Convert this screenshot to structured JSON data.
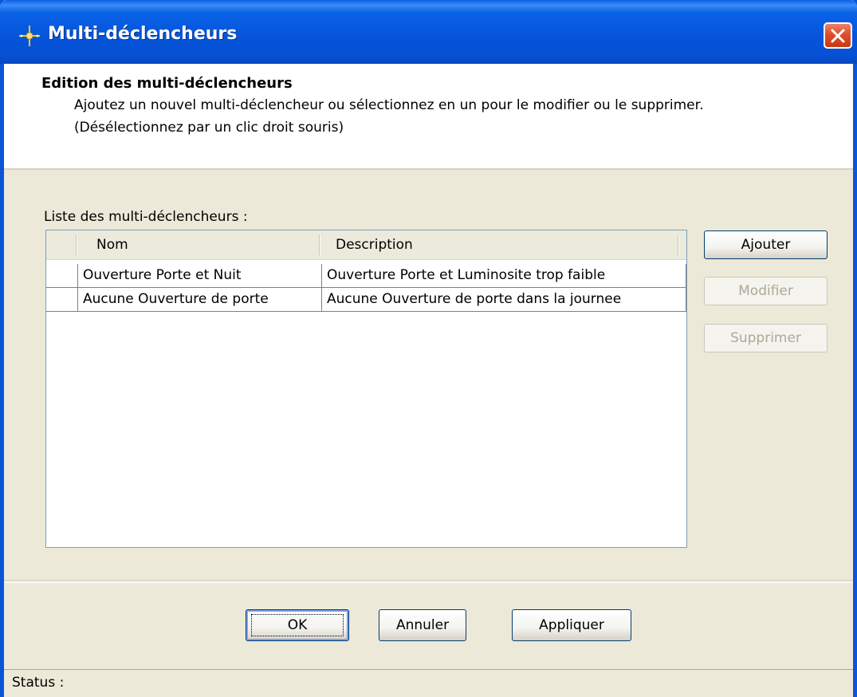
{
  "window": {
    "title": "Multi-déclencheurs",
    "title_icon": "trigger-icon",
    "close_icon": "close-icon"
  },
  "header": {
    "title": "Edition des multi-déclencheurs",
    "description_line1": "Ajoutez un nouvel multi-déclencheur ou sélectionnez en un pour le modifier ou le supprimer.",
    "description_line2": "(Désélectionnez par un clic droit souris)"
  },
  "list": {
    "label": "Liste des multi-déclencheurs :",
    "columns": [
      "",
      "Nom",
      "Description"
    ],
    "rows": [
      {
        "nom": "Ouverture Porte et Nuit",
        "description": "Ouverture Porte et Luminosite trop faible"
      },
      {
        "nom": "Aucune Ouverture de porte",
        "description": "Aucune Ouverture de porte dans la journee"
      }
    ]
  },
  "actions": {
    "add": "Ajouter",
    "edit": "Modifier",
    "delete": "Supprimer"
  },
  "footer": {
    "ok": "OK",
    "cancel": "Annuler",
    "apply": "Appliquer"
  },
  "status": {
    "label": "Status :"
  }
}
